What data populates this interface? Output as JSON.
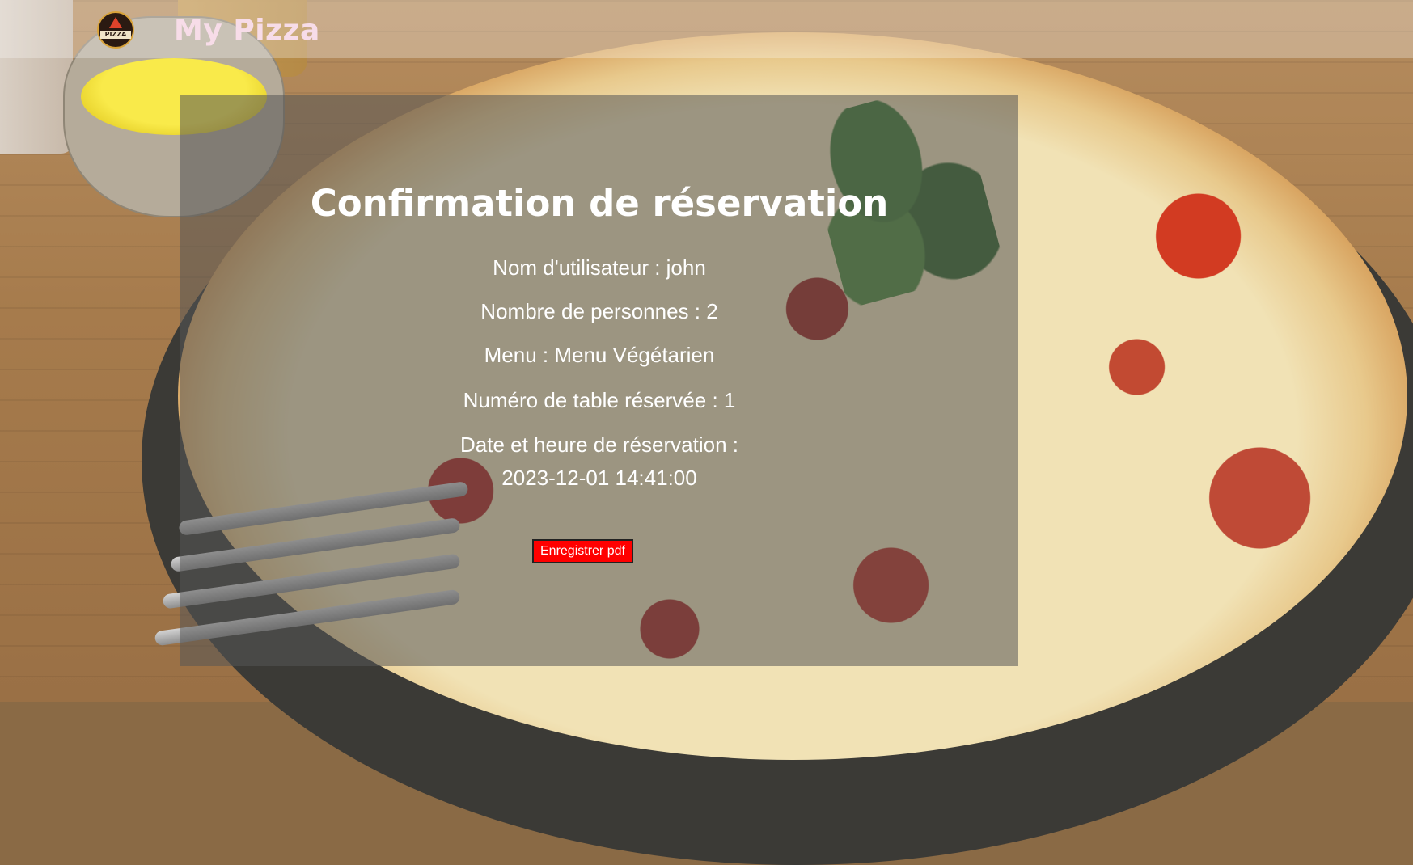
{
  "header": {
    "brand": "My Pizza",
    "logo_text": "PIZZA"
  },
  "confirmation": {
    "title": "Confirmation de réservation",
    "username_line": "Nom d'utilisateur : john",
    "people_line": "Nombre de personnes : 2",
    "menu_line": "Menu : Menu Végétarien",
    "table_line": "Numéro de table réservée : 1",
    "datetime_label": "Date et heure de réservation :",
    "datetime_value": "2023-12-01 14:41:00",
    "pdf_button": "Enregistrer pdf"
  },
  "colors": {
    "brand_text": "#f7dce8",
    "button_bg": "#ff0000",
    "panel_overlay": "#555555"
  },
  "icons": {
    "logo": "pizza-logo-icon"
  }
}
